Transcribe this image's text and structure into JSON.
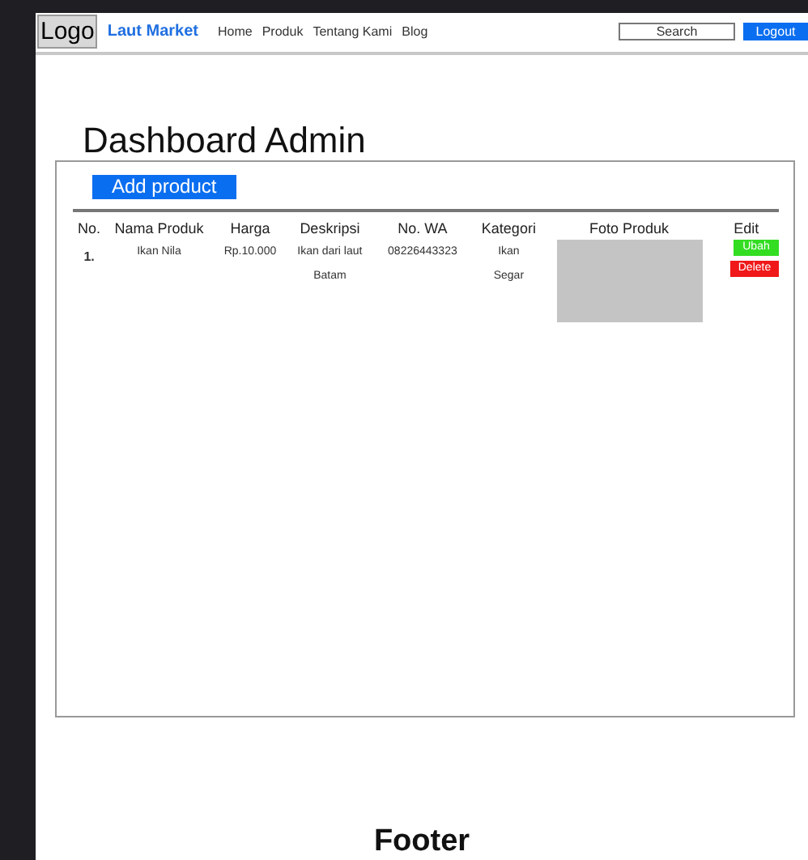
{
  "nav": {
    "logo": "Logo",
    "brand": "Laut Market",
    "links": [
      "Home",
      "Produk",
      "Tentang Kami",
      "Blog"
    ],
    "search": {
      "placeholder": "Search"
    },
    "logout": "Logout"
  },
  "title": "Dashboard Admin",
  "add_button": "Add product",
  "table": {
    "columns": [
      "No.",
      "Nama Produk",
      "Harga",
      "Deskripsi",
      "No. WA",
      "Kategori",
      "Foto Produk",
      "Edit"
    ],
    "rows": [
      {
        "no": "1.",
        "name": "Ikan Nila",
        "price": "Rp.10.000",
        "description": "Ikan dari laut Batam",
        "wa": "08226443323",
        "category": "Ikan Segar",
        "photo": {
          "kind": "placeholder"
        },
        "actions": [
          {
            "label": "Ubah",
            "kind": "edit"
          },
          {
            "label": "Delete",
            "kind": "delete"
          }
        ]
      }
    ]
  },
  "footer": "Footer"
}
